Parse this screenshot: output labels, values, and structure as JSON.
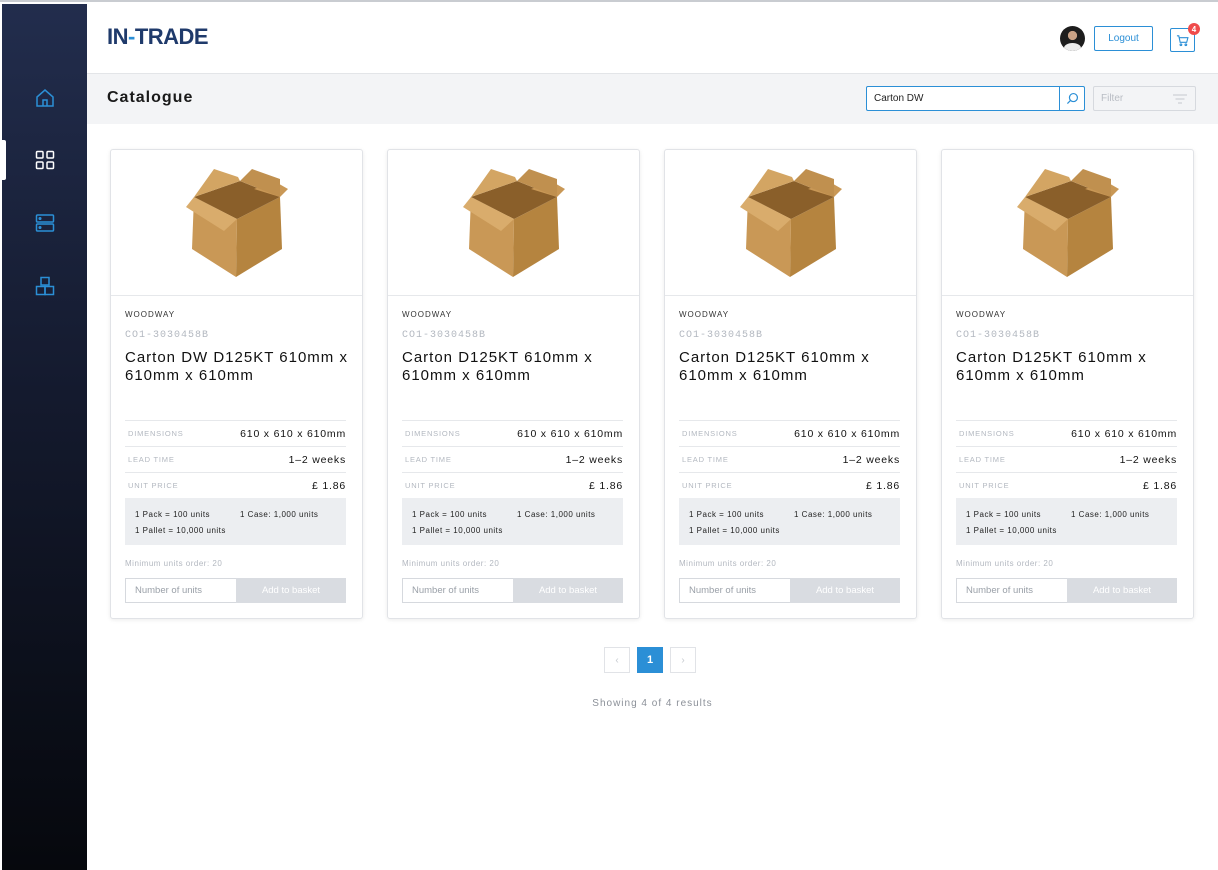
{
  "brand": {
    "name_a": "IN",
    "name_sep": "-",
    "name_b": "TRADE",
    "color_primary": "#1f3a6b",
    "color_accent": "#2b8fd6"
  },
  "sidebar": {
    "items": [
      {
        "icon": "home-icon",
        "active": false
      },
      {
        "icon": "grid-icon",
        "active": true
      },
      {
        "icon": "server-icon",
        "active": false
      },
      {
        "icon": "boxes-icon",
        "active": false
      }
    ]
  },
  "header": {
    "logout_label": "Logout",
    "cart_count": "4"
  },
  "toolbar": {
    "title": "Catalogue",
    "search_value": "Carton DW",
    "filter_placeholder": "Filter"
  },
  "products": [
    {
      "brand": "WOODWAY",
      "code": "CO1-3030458B",
      "name": "Carton DW D125KT 610mm x 610mm x 610mm",
      "specs": [
        {
          "label": "DIMENSIONS",
          "value": "610 x 610 x 610mm"
        },
        {
          "label": "LEAD TIME",
          "value": "1–2 weeks"
        },
        {
          "label": "UNIT PRICE",
          "value": "£ 1.86"
        }
      ],
      "pack": "1 Pack = 100 units",
      "case": "1 Case: 1,000 units",
      "pallet": "1 Pallet = 10,000 units",
      "min_order": "Minimum units order: 20",
      "qty_placeholder": "Number of units",
      "add_label": "Add to basket"
    },
    {
      "brand": "WOODWAY",
      "code": "CO1-3030458B",
      "name": "Carton D125KT 610mm x 610mm x 610mm",
      "specs": [
        {
          "label": "DIMENSIONS",
          "value": "610 x 610 x 610mm"
        },
        {
          "label": "LEAD TIME",
          "value": "1–2 weeks"
        },
        {
          "label": "UNIT PRICE",
          "value": "£ 1.86"
        }
      ],
      "pack": "1 Pack = 100 units",
      "case": "1 Case: 1,000 units",
      "pallet": "1 Pallet = 10,000 units",
      "min_order": "Minimum units order: 20",
      "qty_placeholder": "Number of units",
      "add_label": "Add to basket"
    },
    {
      "brand": "WOODWAY",
      "code": "CO1-3030458B",
      "name": "Carton D125KT 610mm x 610mm x 610mm",
      "specs": [
        {
          "label": "DIMENSIONS",
          "value": "610 x 610 x 610mm"
        },
        {
          "label": "LEAD TIME",
          "value": "1–2 weeks"
        },
        {
          "label": "UNIT PRICE",
          "value": "£ 1.86"
        }
      ],
      "pack": "1 Pack = 100 units",
      "case": "1 Case: 1,000 units",
      "pallet": "1 Pallet = 10,000 units",
      "min_order": "Minimum units order: 20",
      "qty_placeholder": "Number of units",
      "add_label": "Add to basket"
    },
    {
      "brand": "WOODWAY",
      "code": "CO1-3030458B",
      "name": "Carton D125KT 610mm x 610mm x 610mm",
      "specs": [
        {
          "label": "DIMENSIONS",
          "value": "610 x 610 x 610mm"
        },
        {
          "label": "LEAD TIME",
          "value": "1–2 weeks"
        },
        {
          "label": "UNIT PRICE",
          "value": "£ 1.86"
        }
      ],
      "pack": "1 Pack = 100 units",
      "case": "1 Case: 1,000 units",
      "pallet": "1 Pallet = 10,000 units",
      "min_order": "Minimum units order: 20",
      "qty_placeholder": "Number of units",
      "add_label": "Add to basket"
    }
  ],
  "pagination": {
    "prev": "‹",
    "current": "1",
    "next": "›"
  },
  "results_text": "Showing 4 of 4 results"
}
